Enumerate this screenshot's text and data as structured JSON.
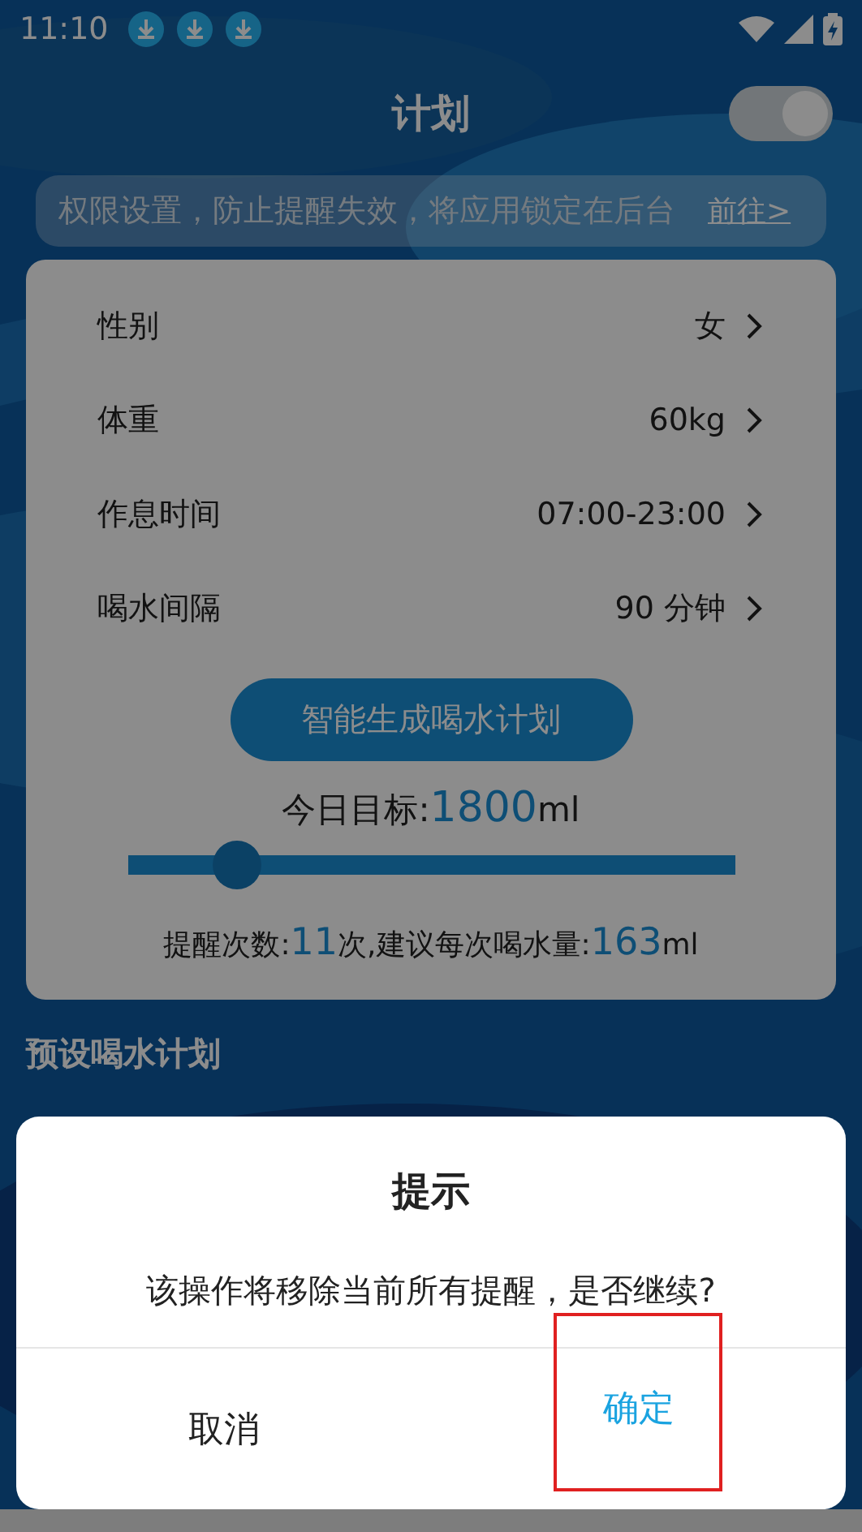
{
  "status_bar": {
    "time": "11:10"
  },
  "header": {
    "title": "计划",
    "switch_on": true
  },
  "banner": {
    "text": "权限设置，防止提醒失效，将应用锁定在后台",
    "link": "前往>"
  },
  "settings": [
    {
      "label": "性别",
      "value": "女"
    },
    {
      "label": "体重",
      "value": "60kg"
    },
    {
      "label": "作息时间",
      "value": "07:00-23:00"
    },
    {
      "label": "喝水间隔",
      "value": "90 分钟"
    }
  ],
  "generate_button": "智能生成喝水计划",
  "goal": {
    "label": "今日目标:",
    "amount": "1800",
    "unit": "ml",
    "level": 0.18
  },
  "summary": {
    "count_label": "提醒次数:",
    "count": "11",
    "count_unit": "次,建议每次喝水量:",
    "per_amount": "163",
    "per_unit": "ml"
  },
  "section_title": "预设喝水计划",
  "dialog": {
    "title": "提示",
    "message": "该操作将移除当前所有提醒，是否继续?",
    "buttons": [
      {
        "label": "取消",
        "kind": "cancel",
        "highlighted": false
      },
      {
        "label": "确定",
        "kind": "confirm",
        "highlighted": true
      }
    ]
  }
}
